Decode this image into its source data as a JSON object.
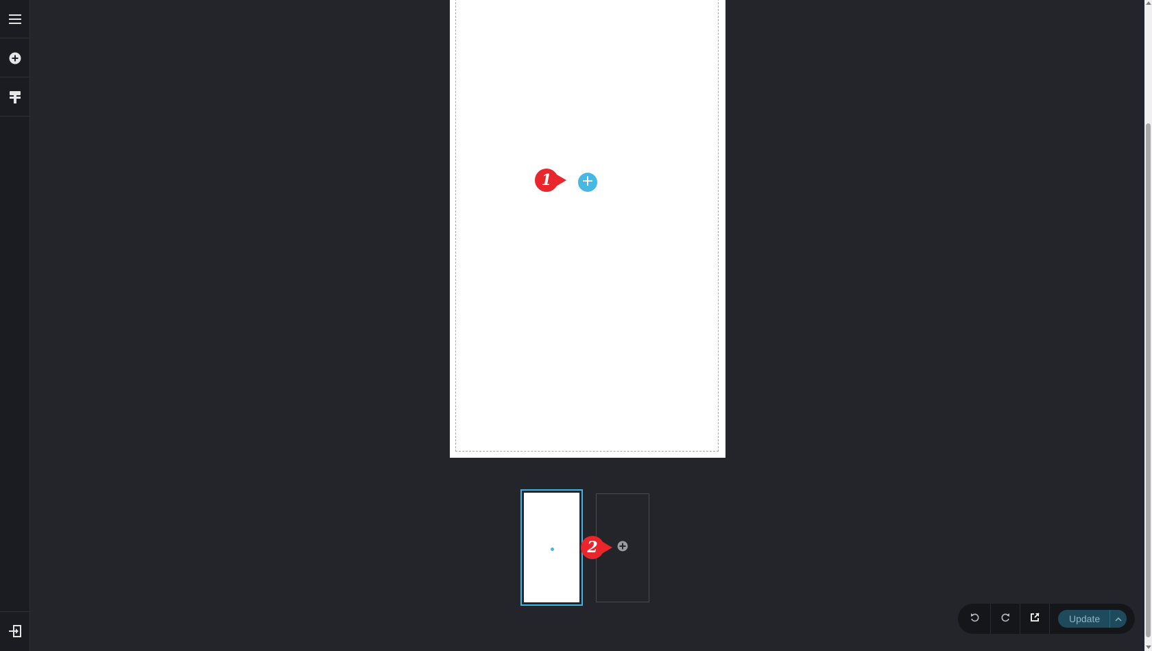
{
  "sidebar": {
    "items": [
      {
        "icon": "menu-icon"
      },
      {
        "icon": "add-circle-icon"
      },
      {
        "icon": "paint-roller-icon"
      }
    ],
    "bottom": {
      "icon": "exit-icon"
    }
  },
  "canvas": {
    "add_button_icon": "plus-icon"
  },
  "annotations": [
    {
      "label": "1",
      "color": "#e8262b"
    },
    {
      "label": "2",
      "color": "#e8262b"
    }
  ],
  "pages": {
    "add_page_icon": "add-circle-icon"
  },
  "toolbar": {
    "undo_icon": "undo-icon",
    "redo_icon": "redo-icon",
    "preview_icon": "external-link-icon",
    "update_label": "Update",
    "caret_icon": "chevron-up-icon"
  },
  "colors": {
    "accent": "#45b8e3",
    "background": "#23252b",
    "sidebar": "#1b1c21",
    "marker": "#e8262b"
  }
}
